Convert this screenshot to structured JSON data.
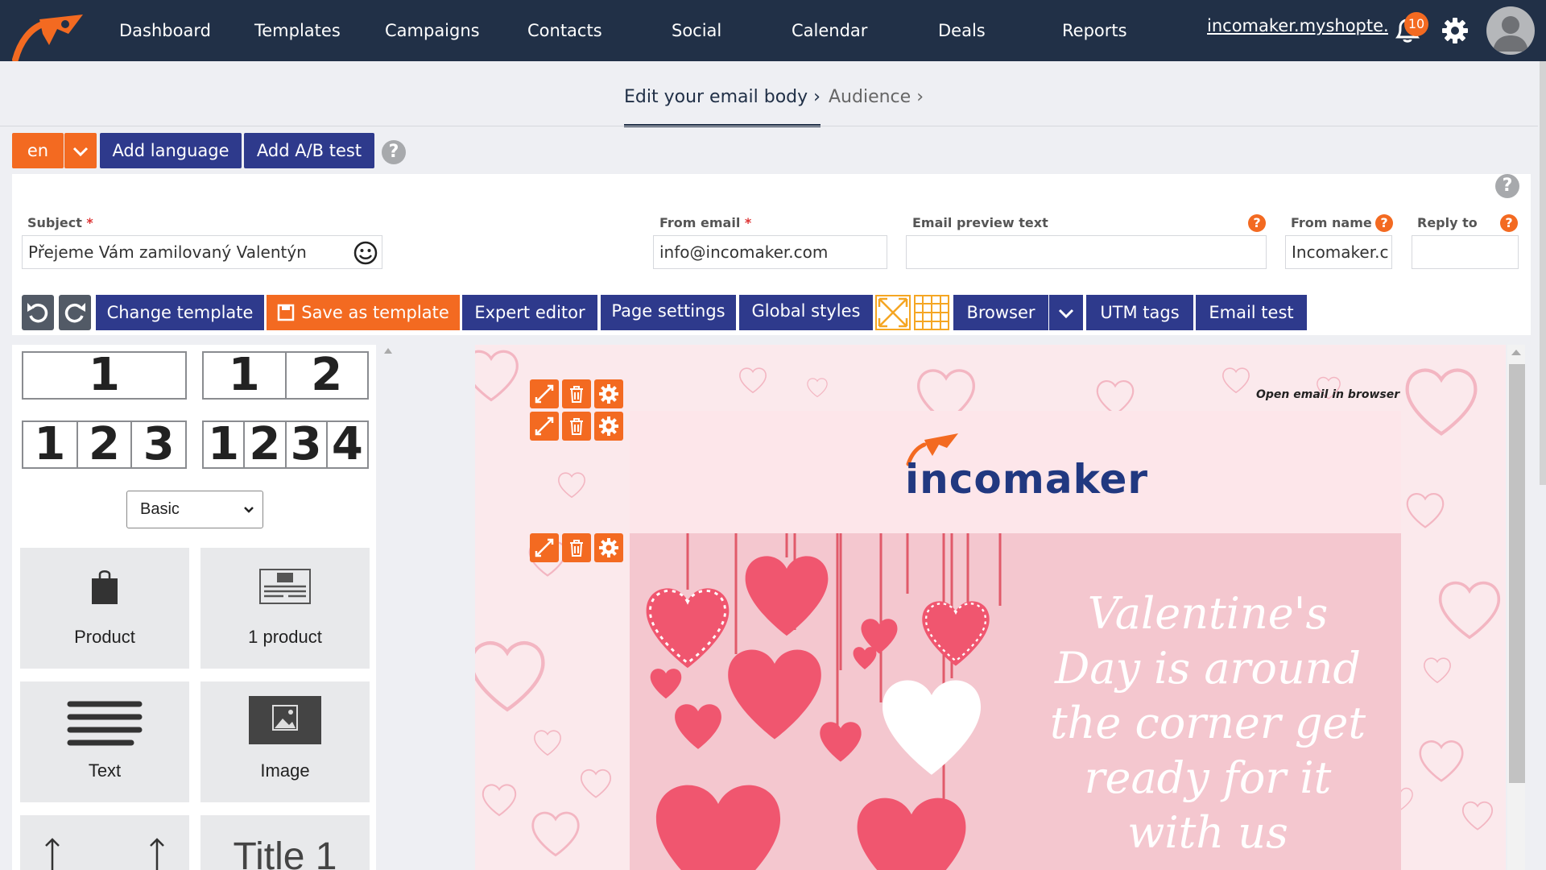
{
  "nav": {
    "items": [
      "Dashboard",
      "Templates",
      "Campaigns",
      "Contacts",
      "Social",
      "Calendar",
      "Deals",
      "Reports"
    ],
    "shop": "incomaker.myshopte...",
    "notifications": "10"
  },
  "steps": {
    "active": "Edit your email body",
    "next": "Audience"
  },
  "langbar": {
    "lang": "en",
    "add_language": "Add language",
    "add_ab": "Add A/B test",
    "help": "?"
  },
  "form": {
    "subject_label": "Subject",
    "subject_value": "Přejeme Vám zamilovaný Valentýn",
    "from_email_label": "From email",
    "from_email_value": "info@incomaker.com",
    "preview_label": "Email preview text",
    "preview_value": "",
    "from_name_label": "From name",
    "from_name_value": "Incomaker.c",
    "reply_label": "Reply to",
    "reply_value": "",
    "required": "*",
    "help": "?"
  },
  "toolbar": {
    "change_template": "Change template",
    "save_as_template": "Save as template",
    "expert_editor": "Expert editor",
    "page_settings": "Page settings",
    "global_styles": "Global styles",
    "browser": "Browser",
    "utm_tags": "UTM tags",
    "email_test": "Email test"
  },
  "blocks": {
    "layouts": [
      [
        "1"
      ],
      [
        "1",
        "2"
      ],
      [
        "1",
        "2",
        "3"
      ],
      [
        "1",
        "2",
        "3",
        "4"
      ]
    ],
    "category": "Basic",
    "tiles": [
      "Product",
      "1 product",
      "Text",
      "Image",
      "",
      "Title 1"
    ]
  },
  "canvas": {
    "open_browser": "Open email in browser",
    "brand": "incomaker",
    "hero_lines": [
      "Valentine's",
      "Day is around",
      "the corner get",
      "ready for it",
      "with us"
    ]
  },
  "colors": {
    "nav_bg": "#213047",
    "accent": "#f36a21",
    "button": "#2e3a8c"
  }
}
